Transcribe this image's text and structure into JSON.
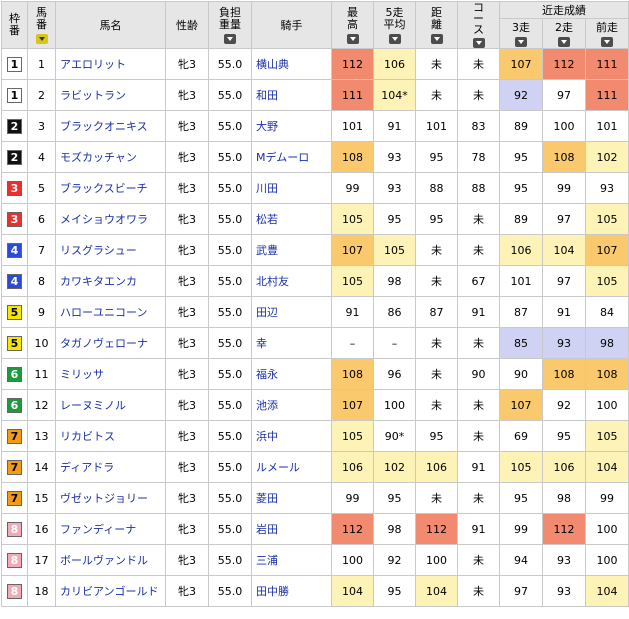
{
  "headers": {
    "waku": "枠\n番",
    "umaban": "馬\n番",
    "name": "馬名",
    "sex_age": "性齢",
    "weight": "負担\n重量",
    "jockey": "騎手",
    "max": "最\n高",
    "avg5": "5走\n平均",
    "distance": "距\n離",
    "course": "コ\nー\nス",
    "recent_group": "近走成績",
    "r3": "3走",
    "r2": "2走",
    "r1": "前走"
  },
  "colors": {
    "waku": {
      "1": {
        "bg": "#ffffff",
        "fg": "#000000"
      },
      "2": {
        "bg": "#111111",
        "fg": "#ffffff"
      },
      "3": {
        "bg": "#e8312f",
        "fg": "#ffffff"
      },
      "4": {
        "bg": "#2b4bd6",
        "fg": "#ffffff"
      },
      "5": {
        "bg": "#f6e600",
        "fg": "#000000"
      },
      "6": {
        "bg": "#1d9a3c",
        "fg": "#ffffff"
      },
      "7": {
        "bg": "#f39a18",
        "fg": "#000000"
      },
      "8": {
        "bg": "#f4a9b8",
        "fg": "#ffffff"
      }
    },
    "tier": {
      "red": "#f28a6f",
      "orange": "#fbc96d",
      "yellow": "#fdf3b6",
      "lav": "#cfd2f3"
    }
  },
  "rows": [
    {
      "waku": "1",
      "umaban": "1",
      "name": "アエロリット",
      "sex_age": "牝3",
      "weight": "55.0",
      "jockey": "横山典",
      "max": "112",
      "avg5": "106",
      "distance": "未",
      "course": "未",
      "r3": "107",
      "r2": "112",
      "r1": "111",
      "hl": {
        "max": "red",
        "avg5": "yellow",
        "r3": "orange",
        "r2": "red",
        "r1": "red"
      }
    },
    {
      "waku": "1",
      "umaban": "2",
      "name": "ラビットラン",
      "sex_age": "牝3",
      "weight": "55.0",
      "jockey": "和田",
      "max": "111",
      "avg5": "104*",
      "distance": "未",
      "course": "未",
      "r3": "92",
      "r2": "97",
      "r1": "111",
      "hl": {
        "max": "red",
        "avg5": "yellow",
        "r3": "lav",
        "r1": "red"
      }
    },
    {
      "waku": "2",
      "umaban": "3",
      "name": "ブラックオニキス",
      "sex_age": "牝3",
      "weight": "55.0",
      "jockey": "大野",
      "max": "101",
      "avg5": "91",
      "distance": "101",
      "course": "83",
      "r3": "89",
      "r2": "100",
      "r1": "101",
      "hl": {}
    },
    {
      "waku": "2",
      "umaban": "4",
      "name": "モズカッチャン",
      "sex_age": "牝3",
      "weight": "55.0",
      "jockey": "Mデムーロ",
      "max": "108",
      "avg5": "93",
      "distance": "95",
      "course": "78",
      "r3": "95",
      "r2": "108",
      "r1": "102",
      "hl": {
        "max": "orange",
        "r2": "orange",
        "r1": "yellow"
      }
    },
    {
      "waku": "3",
      "umaban": "5",
      "name": "ブラックスビーチ",
      "sex_age": "牝3",
      "weight": "55.0",
      "jockey": "川田",
      "max": "99",
      "avg5": "93",
      "distance": "88",
      "course": "88",
      "r3": "95",
      "r2": "99",
      "r1": "93",
      "hl": {}
    },
    {
      "waku": "3",
      "umaban": "6",
      "name": "メイショウオワラ",
      "sex_age": "牝3",
      "weight": "55.0",
      "jockey": "松若",
      "max": "105",
      "avg5": "95",
      "distance": "95",
      "course": "未",
      "r3": "89",
      "r2": "97",
      "r1": "105",
      "hl": {
        "max": "yellow",
        "r1": "yellow"
      }
    },
    {
      "waku": "4",
      "umaban": "7",
      "name": "リスグラシュー",
      "sex_age": "牝3",
      "weight": "55.0",
      "jockey": "武豊",
      "max": "107",
      "avg5": "105",
      "distance": "未",
      "course": "未",
      "r3": "106",
      "r2": "104",
      "r1": "107",
      "hl": {
        "max": "orange",
        "avg5": "yellow",
        "r3": "yellow",
        "r2": "yellow",
        "r1": "orange"
      }
    },
    {
      "waku": "4",
      "umaban": "8",
      "name": "カワキタエンカ",
      "sex_age": "牝3",
      "weight": "55.0",
      "jockey": "北村友",
      "max": "105",
      "avg5": "98",
      "distance": "未",
      "course": "67",
      "r3": "101",
      "r2": "97",
      "r1": "105",
      "hl": {
        "max": "yellow",
        "r1": "yellow"
      }
    },
    {
      "waku": "5",
      "umaban": "9",
      "name": "ハローユニコーン",
      "sex_age": "牝3",
      "weight": "55.0",
      "jockey": "田辺",
      "max": "91",
      "avg5": "86",
      "distance": "87",
      "course": "91",
      "r3": "87",
      "r2": "91",
      "r1": "84",
      "hl": {}
    },
    {
      "waku": "5",
      "umaban": "10",
      "name": "タガノヴェローナ",
      "sex_age": "牝3",
      "weight": "55.0",
      "jockey": "幸",
      "max": "–",
      "avg5": "–",
      "distance": "未",
      "course": "未",
      "r3": "85",
      "r2": "93",
      "r1": "98",
      "hl": {
        "r3": "lav",
        "r2": "lav",
        "r1": "lav"
      }
    },
    {
      "waku": "6",
      "umaban": "11",
      "name": "ミリッサ",
      "sex_age": "牝3",
      "weight": "55.0",
      "jockey": "福永",
      "max": "108",
      "avg5": "96",
      "distance": "未",
      "course": "90",
      "r3": "90",
      "r2": "108",
      "r1": "108",
      "hl": {
        "max": "orange",
        "r2": "orange",
        "r1": "orange"
      }
    },
    {
      "waku": "6",
      "umaban": "12",
      "name": "レーヌミノル",
      "sex_age": "牝3",
      "weight": "55.0",
      "jockey": "池添",
      "max": "107",
      "avg5": "100",
      "distance": "未",
      "course": "未",
      "r3": "107",
      "r2": "92",
      "r1": "100",
      "hl": {
        "max": "orange",
        "r3": "orange"
      }
    },
    {
      "waku": "7",
      "umaban": "13",
      "name": "リカビトス",
      "sex_age": "牝3",
      "weight": "55.0",
      "jockey": "浜中",
      "max": "105",
      "avg5": "90*",
      "distance": "95",
      "course": "未",
      "r3": "69",
      "r2": "95",
      "r1": "105",
      "hl": {
        "max": "yellow",
        "r1": "yellow"
      }
    },
    {
      "waku": "7",
      "umaban": "14",
      "name": "ディアドラ",
      "sex_age": "牝3",
      "weight": "55.0",
      "jockey": "ルメール",
      "max": "106",
      "avg5": "102",
      "distance": "106",
      "course": "91",
      "r3": "105",
      "r2": "106",
      "r1": "104",
      "hl": {
        "max": "yellow",
        "avg5": "yellow",
        "distance": "yellow",
        "r3": "yellow",
        "r2": "yellow",
        "r1": "yellow"
      }
    },
    {
      "waku": "7",
      "umaban": "15",
      "name": "ヴゼットジョリー",
      "sex_age": "牝3",
      "weight": "55.0",
      "jockey": "菱田",
      "max": "99",
      "avg5": "95",
      "distance": "未",
      "course": "未",
      "r3": "95",
      "r2": "98",
      "r1": "99",
      "hl": {}
    },
    {
      "waku": "8",
      "umaban": "16",
      "name": "ファンディーナ",
      "sex_age": "牝3",
      "weight": "55.0",
      "jockey": "岩田",
      "max": "112",
      "avg5": "98",
      "distance": "112",
      "course": "91",
      "r3": "99",
      "r2": "112",
      "r1": "100",
      "hl": {
        "max": "red",
        "distance": "red",
        "r2": "red"
      }
    },
    {
      "waku": "8",
      "umaban": "17",
      "name": "ボールヴァンドル",
      "sex_age": "牝3",
      "weight": "55.0",
      "jockey": "三浦",
      "max": "100",
      "avg5": "92",
      "distance": "100",
      "course": "未",
      "r3": "94",
      "r2": "93",
      "r1": "100",
      "hl": {}
    },
    {
      "waku": "8",
      "umaban": "18",
      "name": "カリビアンゴールド",
      "sex_age": "牝3",
      "weight": "55.0",
      "jockey": "田中勝",
      "max": "104",
      "avg5": "95",
      "distance": "104",
      "course": "未",
      "r3": "97",
      "r2": "93",
      "r1": "104",
      "hl": {
        "max": "yellow",
        "distance": "yellow",
        "r1": "yellow"
      }
    }
  ]
}
